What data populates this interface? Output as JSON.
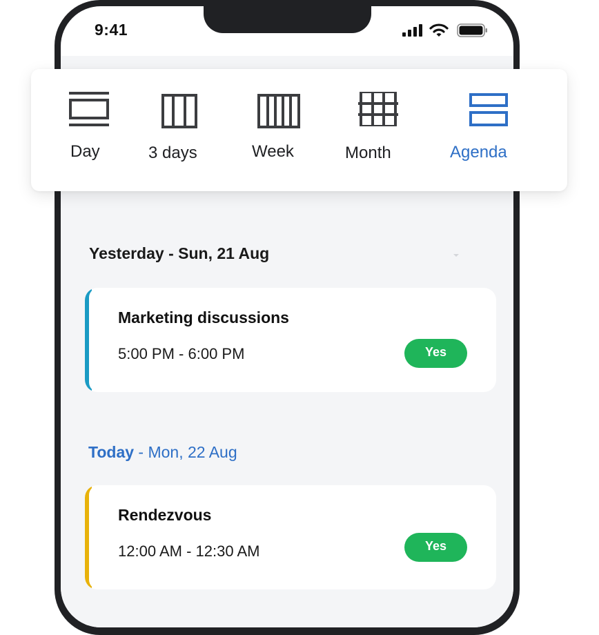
{
  "status_bar": {
    "time": "9:41"
  },
  "view_switcher": {
    "options": [
      {
        "label": "Day",
        "icon": "day-view-icon"
      },
      {
        "label": "3 days",
        "icon": "three-day-view-icon"
      },
      {
        "label": "Week",
        "icon": "week-view-icon"
      },
      {
        "label": "Month",
        "icon": "month-view-icon"
      },
      {
        "label": "Agenda",
        "icon": "agenda-view-icon"
      }
    ],
    "active": "Agenda"
  },
  "agenda": {
    "sections": [
      {
        "relative": "Yesterday",
        "separator": " - ",
        "date": "Sun, 21 Aug",
        "events": [
          {
            "title": "Marketing discussions",
            "time": "5:00 PM - 6:00 PM",
            "rsvp": "Yes",
            "accent": "#1a9bc4"
          }
        ]
      },
      {
        "relative": "Today",
        "separator": " - ",
        "date": "Mon, 22 Aug",
        "events": [
          {
            "title": "Rendezvous",
            "time": "12:00 AM - 12:30 AM",
            "rsvp": "Yes",
            "accent": "#e8b20b"
          }
        ]
      }
    ]
  },
  "colors": {
    "accent_blue": "#2e6fc6",
    "rsvp_green": "#1fb55a",
    "icon_gray": "#3c3d40"
  }
}
